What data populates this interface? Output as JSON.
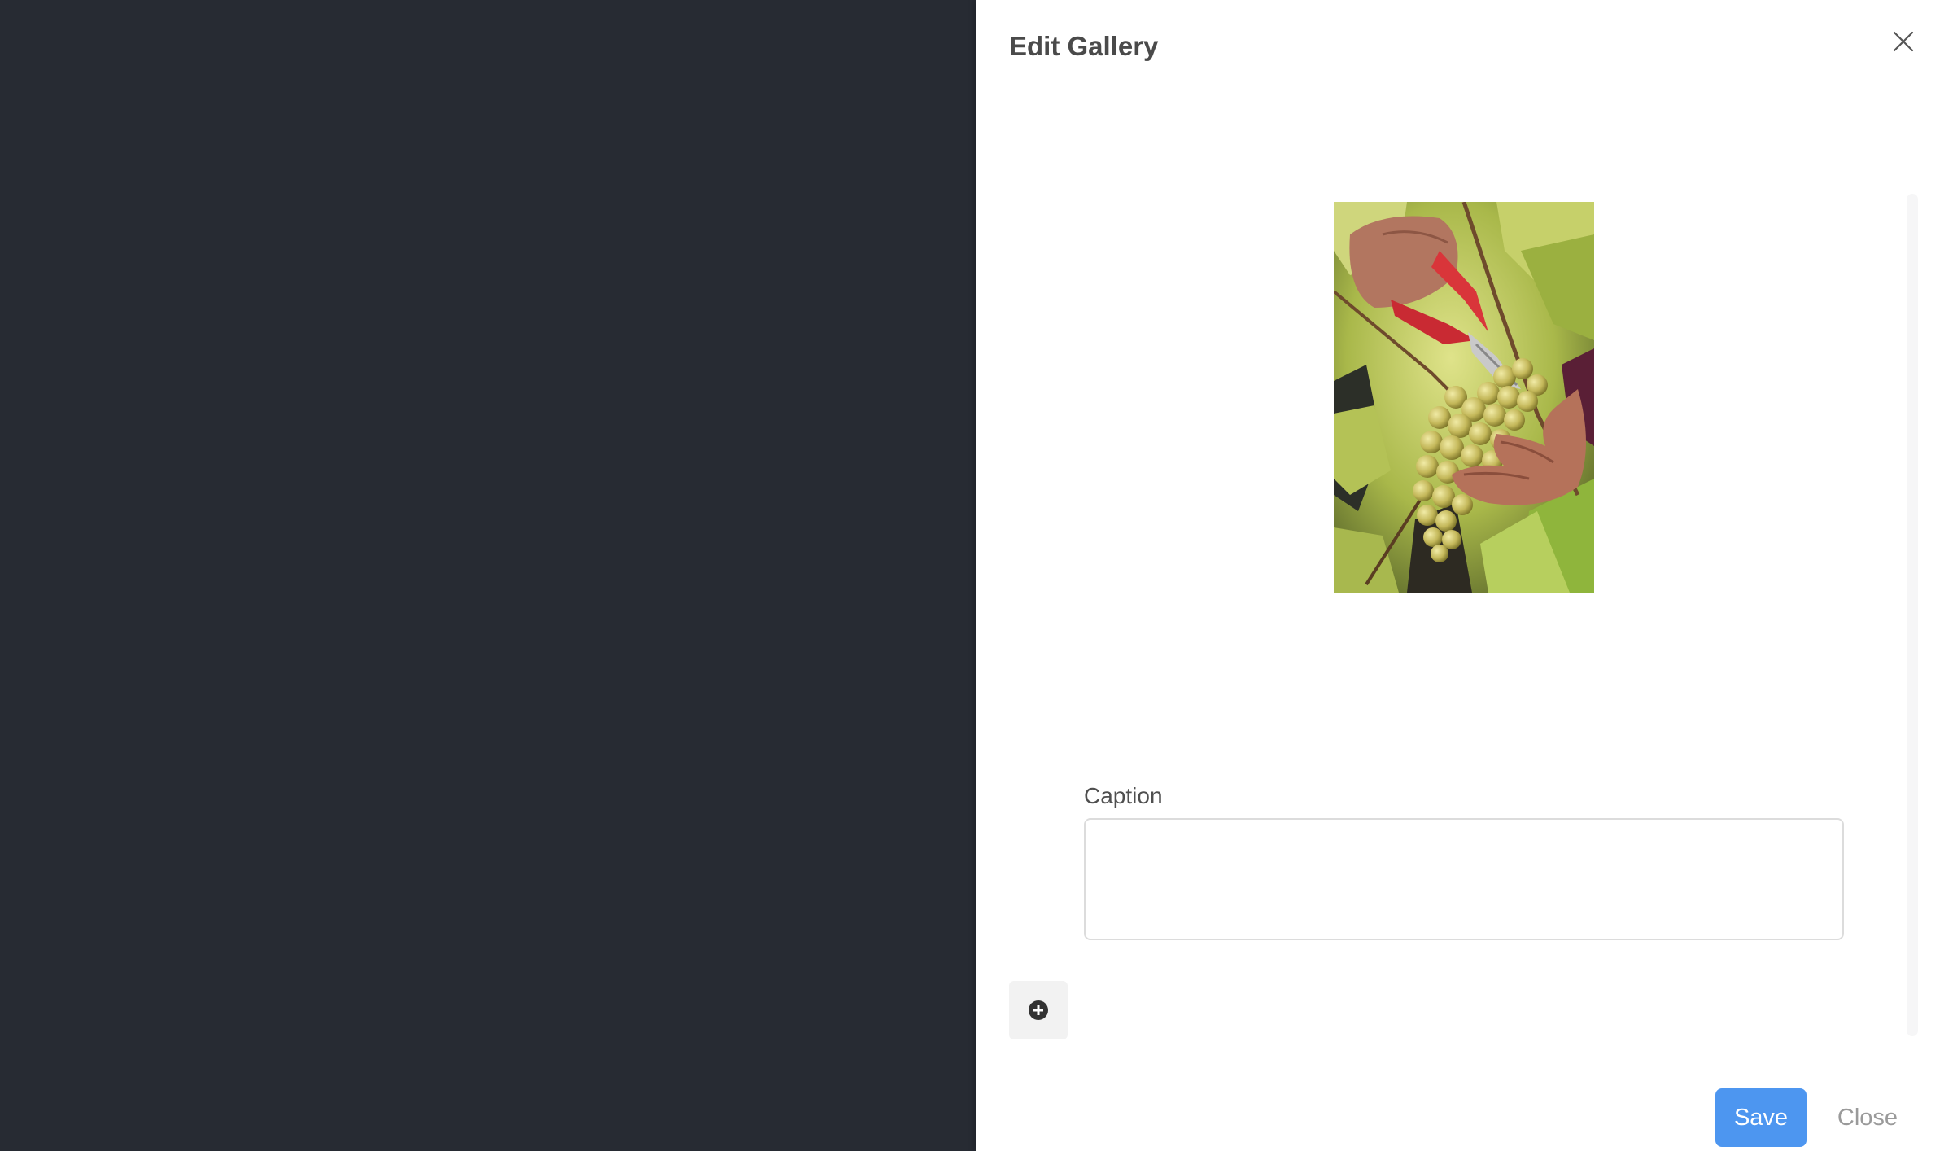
{
  "drawer": {
    "title": "Edit Gallery",
    "close_icon": "close-icon"
  },
  "gallery": {
    "image_subject": "hands cutting a bunch of green grapes with red pruning shears in a vineyard",
    "caption_label": "Caption",
    "caption_value": "",
    "caption_placeholder": "",
    "add_icon": "plus-circle-icon"
  },
  "footer": {
    "save_label": "Save",
    "close_label": "Close"
  },
  "colors": {
    "backdrop": "#272b33",
    "accent": "#4d96f0",
    "title_text": "#4a4a4a"
  }
}
